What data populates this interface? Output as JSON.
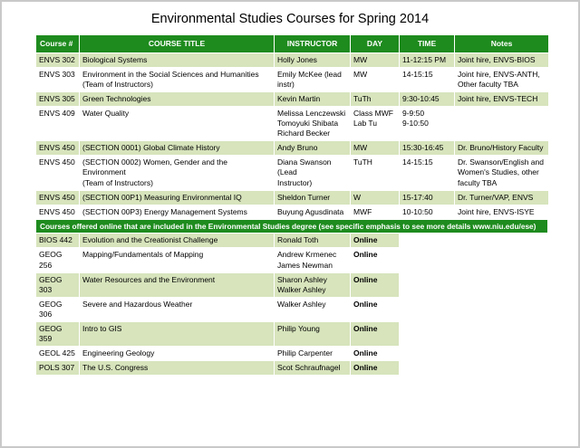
{
  "title": "Environmental Studies Courses for Spring 2014",
  "colors": {
    "header_green": "#1e8b1e",
    "band_green": "#d7e4bc"
  },
  "table": {
    "headers": [
      "Course #",
      "COURSE TITLE",
      "INSTRUCTOR",
      "DAY",
      "TIME",
      "Notes"
    ],
    "rows": [
      {
        "course": "ENVS 302",
        "title": "Biological Systems",
        "instructor": "Holly Jones",
        "day": "MW",
        "time": "11-12:15 PM",
        "notes": "Joint hire, ENVS-BIOS"
      },
      {
        "course": "ENVS 303",
        "title": "Environment in the Social Sciences and Humanities\n(Team of Instructors)",
        "instructor": "Emily McKee (lead\ninstr)",
        "day": "MW",
        "time": "14-15:15",
        "notes": "Joint hire, ENVS-ANTH,\nOther faculty TBA"
      },
      {
        "course": "ENVS 305",
        "title": "Green Technologies",
        "instructor": "Kevin Martin",
        "day": "TuTh",
        "time": "9:30-10:45",
        "notes": "Joint hire, ENVS-TECH"
      },
      {
        "course": "ENVS 409",
        "title": "Water Quality",
        "instructor": "Melissa Lenczewski\nTomoyuki Shibata\nRichard Becker",
        "day": "Class MWF\nLab Tu",
        "time": "9-9:50\n9-10:50",
        "notes": ""
      },
      {
        "course": "ENVS 450",
        "title": "(SECTION 0001) Global Climate History",
        "instructor": "Andy Bruno",
        "day": "MW",
        "time": "15:30-16:45",
        "notes": "Dr. Bruno/History Faculty"
      },
      {
        "course": "ENVS 450",
        "title": "(SECTION 0002) Women, Gender and the Environment\n(Team of Instructors)",
        "instructor": "Diana Swanson (Lead\nInstructor)",
        "day": "TuTH",
        "time": "14-15:15",
        "notes": "Dr. Swanson/English and\nWomen's Studies, other\nfaculty TBA"
      },
      {
        "course": "ENVS 450",
        "title": "(SECTION 00P1) Measuring Environmental IQ",
        "instructor": "Sheldon Turner",
        "day": "W",
        "time": "15-17:40",
        "notes": "Dr. Turner/VAP, ENVS"
      },
      {
        "course": "ENVS 450",
        "title": "(SECTION 00P3) Energy Management Systems",
        "instructor": "Buyung Agusdinata",
        "day": "MWF",
        "time": "10-10:50",
        "notes": "Joint hire, ENVS-ISYE"
      }
    ]
  },
  "banner": "Courses offered online that are included in the Environmental Studies degree (see specific emphasis to see more details www.niu.edu/ese)",
  "online_table": {
    "rows": [
      {
        "course": "BIOS 442",
        "title": "Evolution and the Creationist Challenge",
        "instructor": "Ronald Toth",
        "day": "Online"
      },
      {
        "course": "GEOG 256",
        "title": "Mapping/Fundamentals of Mapping",
        "instructor": "Andrew Krmenec\nJames Newman",
        "day": "Online"
      },
      {
        "course": "GEOG 303",
        "title": "Water Resources and the Environment",
        "instructor": "Sharon Ashley\nWalker Ashley",
        "day": "Online"
      },
      {
        "course": "GEOG 306",
        "title": "Severe and Hazardous Weather",
        "instructor": "Walker Ashley",
        "day": "Online"
      },
      {
        "course": "GEOG 359",
        "title": "Intro to GIS",
        "instructor": "Philip Young",
        "day": "Online"
      },
      {
        "course": "GEOL 425",
        "title": "Engineering Geology",
        "instructor": "Philip Carpenter",
        "day": "Online"
      },
      {
        "course": "POLS 307",
        "title": "The U.S. Congress",
        "instructor": "Scot Schraufnagel",
        "day": "Online"
      }
    ]
  }
}
